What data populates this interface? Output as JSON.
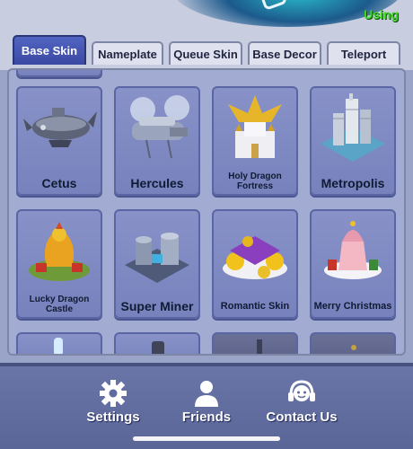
{
  "header": {
    "status_label": "Using"
  },
  "tabs": [
    {
      "label": "Base Skin",
      "active": true
    },
    {
      "label": "Nameplate",
      "active": false
    },
    {
      "label": "Queue Skin",
      "active": false
    },
    {
      "label": "Base Decor",
      "active": false
    },
    {
      "label": "Teleport",
      "active": false
    }
  ],
  "skins": [
    {
      "name": "Cetus",
      "art": "airship-whale-icon"
    },
    {
      "name": "Hercules",
      "art": "flying-fortress-icon"
    },
    {
      "name": "Holy Dragon Fortress",
      "art": "golden-dragon-castle-icon"
    },
    {
      "name": "Metropolis",
      "art": "city-skyline-icon"
    },
    {
      "name": "Lucky Dragon Castle",
      "art": "lucky-dragon-icon"
    },
    {
      "name": "Super Miner",
      "art": "mining-base-icon"
    },
    {
      "name": "Romantic Skin",
      "art": "flower-castle-icon"
    },
    {
      "name": "Merry Christmas",
      "art": "christmas-castle-icon"
    }
  ],
  "bottom_nav": [
    {
      "label": "Settings",
      "icon": "gear-icon"
    },
    {
      "label": "Friends",
      "icon": "person-icon"
    },
    {
      "label": "Contact Us",
      "icon": "headset-icon"
    }
  ],
  "colors": {
    "accent_tab": "#3a49a3",
    "status_green": "#3ad61f",
    "card_bg": "#7782bd",
    "bottom_bar": "#5b6698"
  }
}
